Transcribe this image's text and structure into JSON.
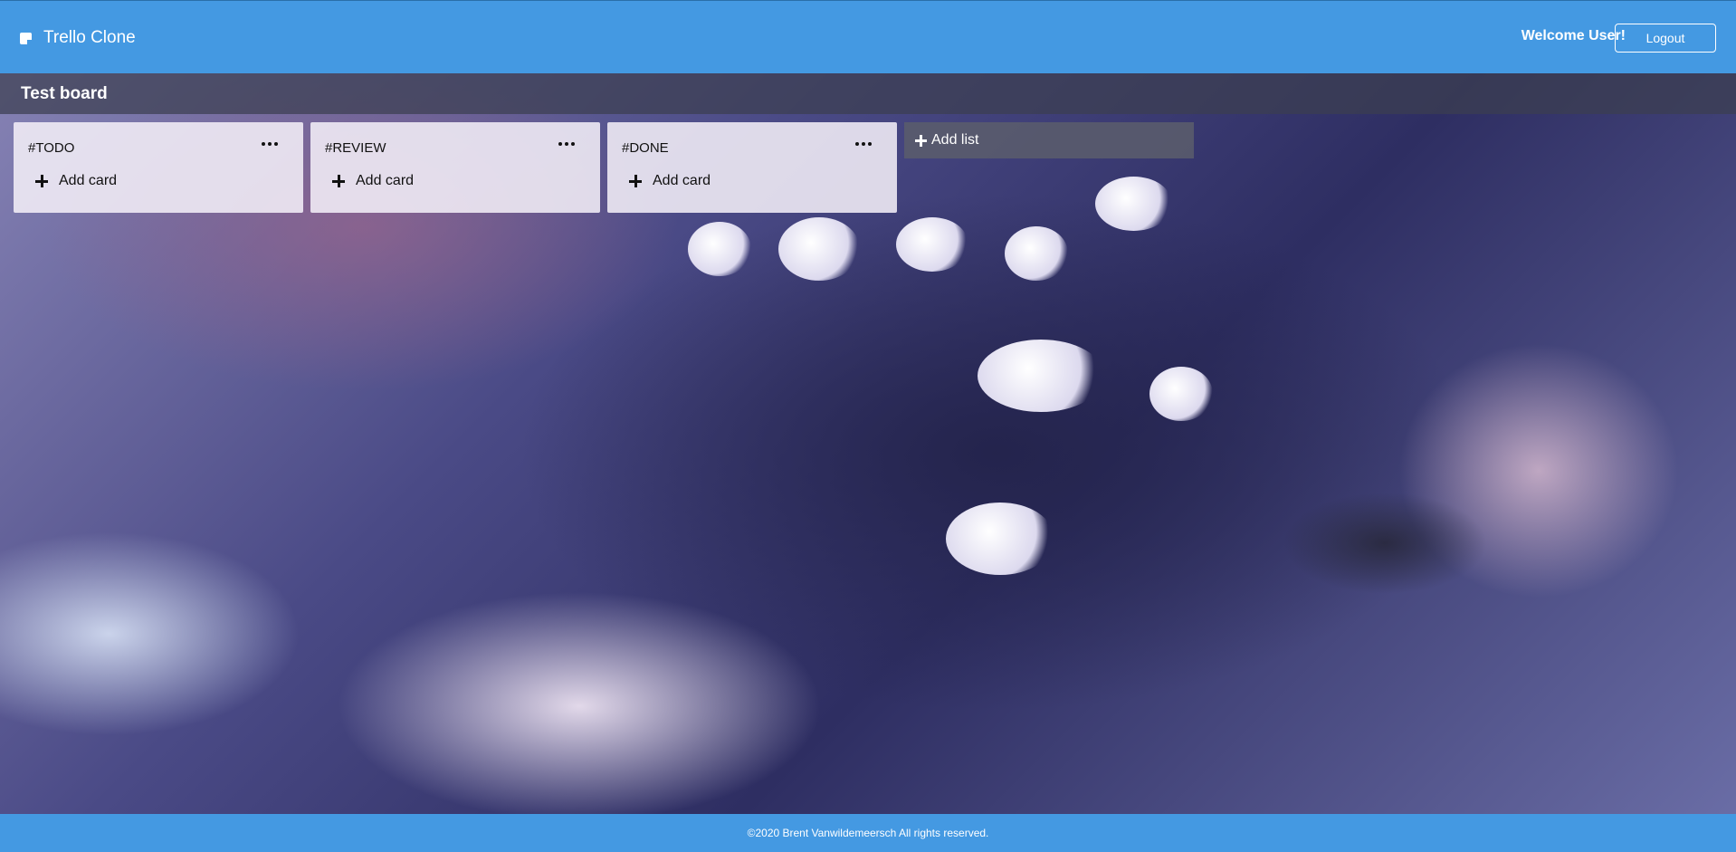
{
  "header": {
    "brand": "Trello Clone",
    "brand_icon": "sticky-note-icon",
    "welcome": "Welcome User!",
    "logout_label": "Logout"
  },
  "board": {
    "title": "Test board",
    "lists": [
      {
        "title": "#TODO",
        "add_card_label": "Add card"
      },
      {
        "title": "#REVIEW",
        "add_card_label": "Add card"
      },
      {
        "title": "#DONE",
        "add_card_label": "Add card"
      }
    ],
    "add_list_label": "Add list"
  },
  "footer": {
    "text": "©2020 Brent Vanwildemeersch All rights reserved."
  },
  "colors": {
    "header": "#4499e2",
    "footer": "#4499e2"
  }
}
